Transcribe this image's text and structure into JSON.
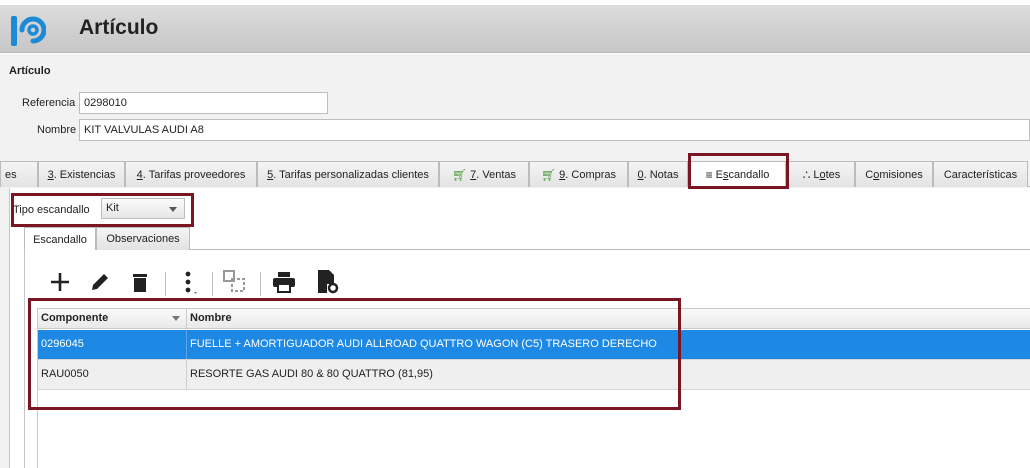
{
  "app": {
    "title": "Artículo",
    "logo_color": "#1c8ad6"
  },
  "form": {
    "section_title": "Artículo",
    "referencia_label": "Referencia",
    "referencia_value": "0298010",
    "nombre_label": "Nombre",
    "nombre_value": "KIT VALVULAS AUDI A8"
  },
  "tabs": [
    {
      "label": "es"
    },
    {
      "key": "3",
      "label": ". Existencias"
    },
    {
      "key": "4",
      "label": ". Tarifas proveedores"
    },
    {
      "key": "5",
      "label": ". Tarifas personalizadas clientes"
    },
    {
      "key": "7",
      "label": ". Ventas",
      "icon": "cart-icon"
    },
    {
      "key": "9",
      "label": ". Compras",
      "icon": "cart-add-icon"
    },
    {
      "key": "0",
      "label": ". Notas"
    },
    {
      "label_pre": "E",
      "label_u": "s",
      "label_post": "candallo",
      "icon": "tree-icon",
      "active": true
    },
    {
      "label_pre": "L",
      "label_u": "o",
      "label_post": "tes",
      "icon": "lots-icon"
    },
    {
      "label_pre": "C",
      "label_u": "o",
      "label_post": "misiones"
    },
    {
      "label": "Características"
    }
  ],
  "escandallo": {
    "tipo_label": "Tipo escandallo",
    "tipo_value": "Kit",
    "subtabs": [
      {
        "label": "Escandallo",
        "active": true
      },
      {
        "label": "Observaciones"
      }
    ],
    "toolbar_icons": [
      "add-icon",
      "edit-icon",
      "delete-icon",
      "more-icon",
      "copy-icon",
      "print-icon",
      "settings-doc-icon"
    ],
    "columns": [
      "Componente",
      "Nombre"
    ],
    "rows": [
      {
        "componente": "0296045",
        "nombre": "FUELLE + AMORTIGUADOR  AUDI ALLROAD QUATTRO WAGON (C5)  TRASERO DERECHO",
        "selected": true
      },
      {
        "componente": "RAU0050",
        "nombre": "RESORTE GAS  AUDI 80 & 80 QUATTRO  (81,95)"
      }
    ]
  },
  "colors": {
    "selection": "#1e88e5",
    "highlight_box": "#7a1523"
  }
}
